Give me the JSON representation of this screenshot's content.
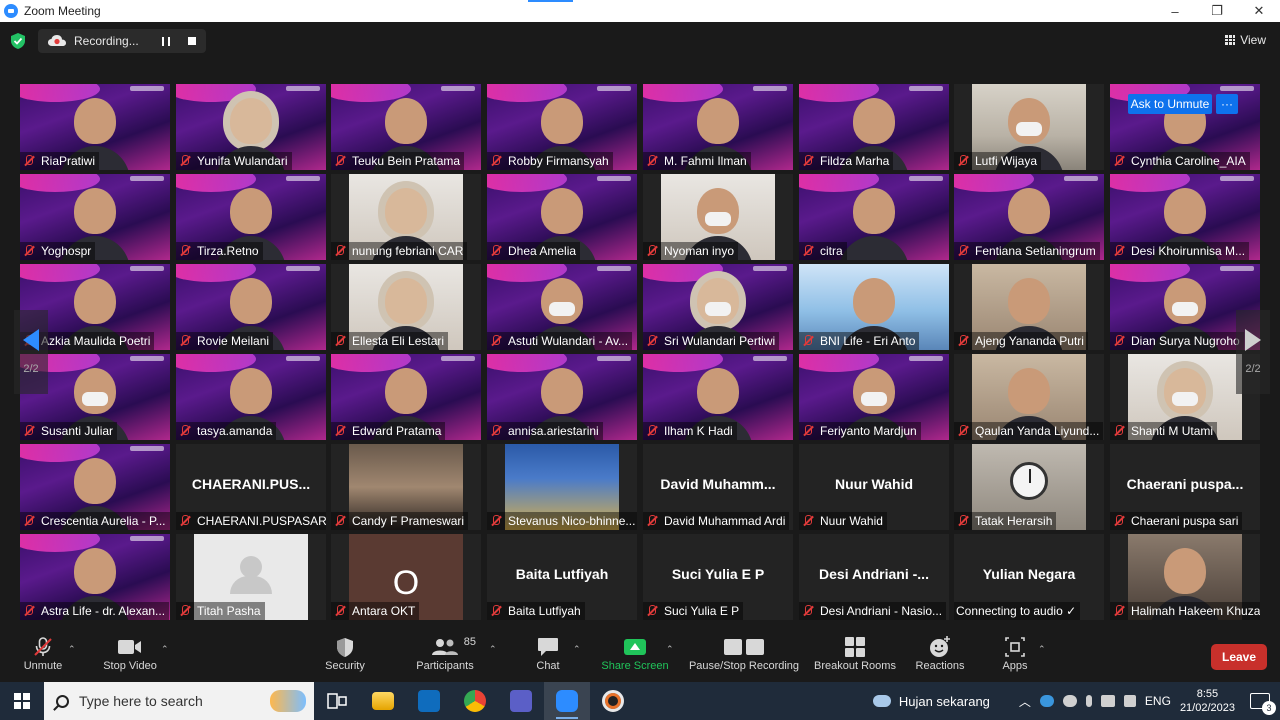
{
  "window": {
    "title": "Zoom Meeting",
    "minimize": "–",
    "maximize": "❐",
    "close": "✕"
  },
  "topbar": {
    "recording_label": "Recording...",
    "view_label": "View"
  },
  "colors": {
    "accent": "#2d8cff",
    "leave": "#c8302b",
    "share": "#20c45a",
    "muted": "#e03a3a"
  },
  "gallery": {
    "page_indicator_left": "2/2",
    "page_indicator_right": "2/2",
    "ask_to_unmute": "Ask to Unmute",
    "tile_menu": "···",
    "tiles": [
      {
        "name": "RiaPratiwi",
        "bg": "purple"
      },
      {
        "name": "Yunifa Wulandari",
        "bg": "purple"
      },
      {
        "name": "Teuku Bein Pratama",
        "bg": "purple"
      },
      {
        "name": "Robby Firmansyah",
        "bg": "purple"
      },
      {
        "name": "M. Fahmi Ilman",
        "bg": "purple"
      },
      {
        "name": "Fildza Marha",
        "bg": "purple"
      },
      {
        "name": "Lutfi Wijaya",
        "bg": "office"
      },
      {
        "name": "Cynthia Caroline_AIA",
        "bg": "purple"
      },
      {
        "name": "Yoghospr",
        "bg": "purple"
      },
      {
        "name": "Tirza.Retno",
        "bg": "purple"
      },
      {
        "name": "nunung febriani CAR",
        "bg": "light"
      },
      {
        "name": "Dhea Amelia",
        "bg": "purple"
      },
      {
        "name": "Nyoman inyo",
        "bg": "light"
      },
      {
        "name": "citra",
        "bg": "purple"
      },
      {
        "name": "Fentiana Setianingrum",
        "bg": "purple"
      },
      {
        "name": "Desi Khoirunnisa M...",
        "bg": "purple"
      },
      {
        "name": "Azkia Maulida Poetri",
        "bg": "purple"
      },
      {
        "name": "Rovie Meilani",
        "bg": "purple"
      },
      {
        "name": "Ellesta Eli Lestari",
        "bg": "light"
      },
      {
        "name": "Astuti Wulandari - Av...",
        "bg": "purple"
      },
      {
        "name": "Sri Wulandari Pertiwi",
        "bg": "purple"
      },
      {
        "name": "BNI Life - Eri Anto",
        "bg": "blue"
      },
      {
        "name": "Ajeng Yananda Putri",
        "bg": "warm"
      },
      {
        "name": "Dian Surya Nugroho",
        "bg": "purple"
      },
      {
        "name": "Susanti Juliar",
        "bg": "purple"
      },
      {
        "name": "tasya.amanda",
        "bg": "purple"
      },
      {
        "name": "Edward Pratama",
        "bg": "purple"
      },
      {
        "name": "annisa.ariestarini",
        "bg": "purple"
      },
      {
        "name": "Ilham K Hadi",
        "bg": "purple"
      },
      {
        "name": "Feriyanto Mardjun",
        "bg": "purple"
      },
      {
        "name": "Qaulan Yanda Liyund...",
        "bg": "warm"
      },
      {
        "name": "Shanti M Utami",
        "bg": "light"
      },
      {
        "name": "Crescentia Aurelia - P...",
        "bg": "purple"
      },
      {
        "name": "CHAERANI.PUSPASARI",
        "bg": "none",
        "big": "CHAERANI.PUS..."
      },
      {
        "name": "Candy F Prameswari",
        "bg": "room"
      },
      {
        "name": "Stevanus Nico-bhinne...",
        "bg": "hall"
      },
      {
        "name": "David Muhammad Ardi",
        "bg": "none",
        "big": "David  Muhamm..."
      },
      {
        "name": "Nuur Wahid",
        "bg": "none",
        "big": "Nuur Wahid"
      },
      {
        "name": "Tatak Herarsih",
        "bg": "clock"
      },
      {
        "name": "Chaerani puspa sari",
        "bg": "none",
        "big": "Chaerani  puspa..."
      },
      {
        "name": "Astra Life - dr. Alexan...",
        "bg": "purple"
      },
      {
        "name": "Titah Pasha",
        "bg": "gray"
      },
      {
        "name": "Antara OKT",
        "bg": "brown",
        "initial": "O"
      },
      {
        "name": "Baita Lutfiyah",
        "bg": "none",
        "big": "Baita Lutfiyah"
      },
      {
        "name": "Suci Yulia E P",
        "bg": "none",
        "big": "Suci Yulia E P"
      },
      {
        "name": "Desi Andriani - Nasio...",
        "bg": "none",
        "big": "Desi  Andriani  -..."
      },
      {
        "name": "Connecting to audio ✓",
        "bg": "none",
        "big": "Yulian Negara",
        "nomic": true
      },
      {
        "name": "Halimah Hakeem Khuzai...",
        "bg": "car"
      }
    ]
  },
  "toolbar": {
    "unmute": "Unmute",
    "stop_video": "Stop Video",
    "security": "Security",
    "participants": "Participants",
    "participants_count": "85",
    "chat": "Chat",
    "share_screen": "Share Screen",
    "pause_recording": "Pause/Stop Recording",
    "breakout": "Breakout Rooms",
    "reactions": "Reactions",
    "apps": "Apps",
    "leave": "Leave"
  },
  "taskbar": {
    "search_placeholder": "Type here to search",
    "weather": "Hujan sekarang",
    "language": "ENG",
    "time": "8:55",
    "date": "21/02/2023",
    "notifications": "3",
    "apps": [
      "task-view-icon",
      "file-explorer-icon",
      "outlook-icon",
      "chrome-icon",
      "teams-icon",
      "zoom-icon",
      "media-player-icon"
    ]
  }
}
